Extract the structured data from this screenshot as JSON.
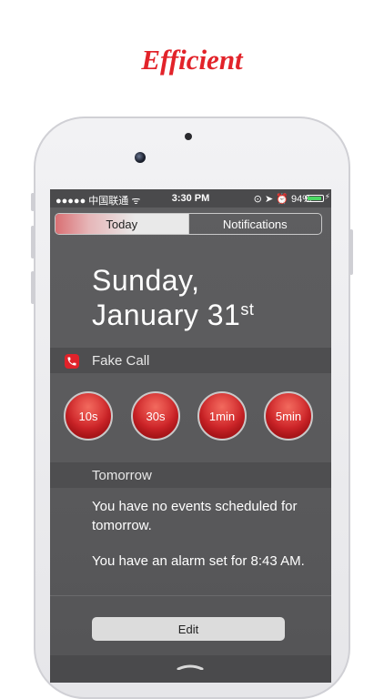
{
  "headline": "Efficient",
  "status_bar": {
    "carrier": "●●●●● 中国联通 ᯤ",
    "time": "3:30 PM",
    "right_icons": "⊙ ➤ ⏰ 94%",
    "battery_level": 0.94,
    "battery_color": "#4cd964"
  },
  "segmented_control": {
    "today": "Today",
    "notifications": "Notifications"
  },
  "date": {
    "line1": "Sunday,",
    "line2": "January 31",
    "suffix": "st"
  },
  "fake_call": {
    "title": "Fake Call",
    "icon": "phone-icon",
    "buttons": [
      "10s",
      "30s",
      "1min",
      "5min"
    ],
    "accent": "#d0262a"
  },
  "tomorrow": {
    "title": "Tomorrow",
    "no_events": "You have no events scheduled for tomorrow.",
    "alarm": "You have an alarm set for 8:43 AM."
  },
  "edit_label": "Edit"
}
